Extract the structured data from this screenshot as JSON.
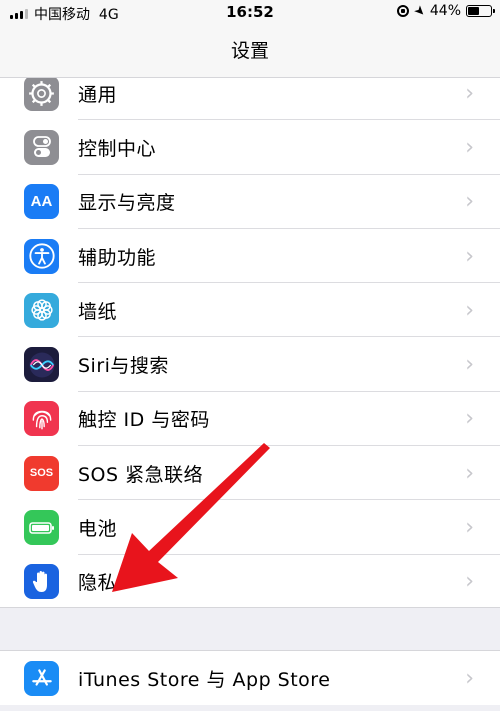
{
  "status": {
    "carrier": "中国移动",
    "network": "4G",
    "time": "16:52",
    "battery_text": "44%",
    "battery_level": 0.44
  },
  "nav": {
    "title": "设置"
  },
  "items": [
    {
      "label": "通用",
      "icon": "gear-icon",
      "color": "#8e8e93"
    },
    {
      "label": "控制中心",
      "icon": "control-center-icon",
      "color": "#8e8e93"
    },
    {
      "label": "显示与亮度",
      "icon": "display-brightness-icon",
      "color": "#1a7cf5",
      "glyph": "AA"
    },
    {
      "label": "辅助功能",
      "icon": "accessibility-icon",
      "color": "#1a7cf5"
    },
    {
      "label": "墙纸",
      "icon": "wallpaper-icon",
      "color": "#35aadc"
    },
    {
      "label": "Siri与搜索",
      "icon": "siri-icon",
      "color": "#1c1c3c"
    },
    {
      "label": "触控 ID 与密码",
      "icon": "touch-id-icon",
      "color": "#f0344f"
    },
    {
      "label": "SOS 紧急联络",
      "icon": "sos-icon",
      "color": "#f03a2e",
      "glyph": "SOS"
    },
    {
      "label": "电池",
      "icon": "battery-icon",
      "color": "#34c759"
    },
    {
      "label": "隐私",
      "icon": "privacy-hand-icon",
      "color": "#1a63e0"
    }
  ],
  "items2": [
    {
      "label": "iTunes Store 与 App Store",
      "icon": "app-store-icon",
      "color": "#1a8cf5"
    }
  ],
  "annotation": {
    "icon": "red-pointer-arrow",
    "color": "#e8141c"
  }
}
